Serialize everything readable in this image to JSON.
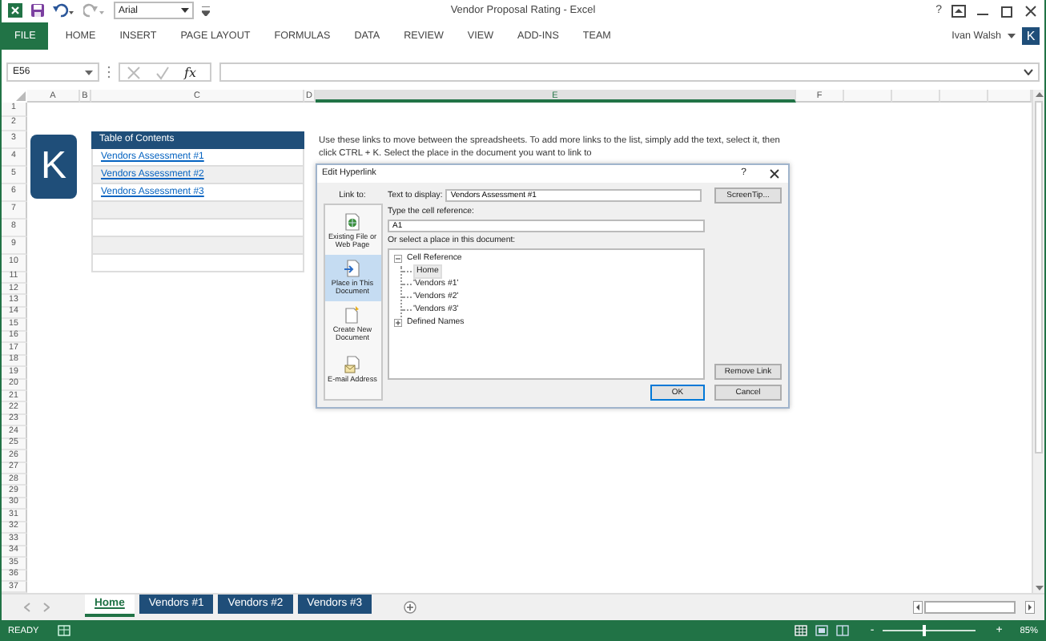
{
  "title_bar": {
    "font_box": "Arial",
    "title": "Vendor Proposal Rating - Excel",
    "help": "?"
  },
  "ribbon_tabs": [
    {
      "label": "FILE",
      "kind": "file"
    },
    {
      "label": "HOME",
      "kind": "tab"
    },
    {
      "label": "INSERT",
      "kind": "tab"
    },
    {
      "label": "PAGE LAYOUT",
      "kind": "tab"
    },
    {
      "label": "FORMULAS",
      "kind": "tab"
    },
    {
      "label": "DATA",
      "kind": "tab"
    },
    {
      "label": "REVIEW",
      "kind": "tab"
    },
    {
      "label": "VIEW",
      "kind": "tab"
    },
    {
      "label": "ADD-INS",
      "kind": "tab"
    },
    {
      "label": "TEAM",
      "kind": "tab"
    }
  ],
  "account": {
    "user": "Ivan Walsh",
    "avatar": "K"
  },
  "formula_bar": {
    "name_box": "E56",
    "function_label": "fx"
  },
  "columns": [
    "A",
    "B",
    "C",
    "D",
    "E",
    "F"
  ],
  "rows": [
    "1",
    "2",
    "3",
    "4",
    "5",
    "6",
    "7",
    "8",
    "9",
    "10",
    "11",
    "12",
    "13",
    "14",
    "15",
    "16",
    "17",
    "18",
    "19",
    "20",
    "21",
    "22",
    "23",
    "24",
    "25",
    "26",
    "27",
    "28",
    "29",
    "30",
    "31",
    "32",
    "33",
    "34",
    "35",
    "36",
    "37"
  ],
  "logo": {
    "letter": "K"
  },
  "toc": {
    "title": "Table of Contents",
    "links": [
      "Vendors Assessment #1",
      "Vendors Assessment #2",
      "Vendors Assessment #3"
    ]
  },
  "instructions": "Use these links to move between the spreadsheets. To add more links to the list, simply add the text, select it, then click CTRL + K. Select the place in the document you want to link to",
  "dialog": {
    "title": "Edit Hyperlink",
    "help": "?",
    "link_to_label": "Link to:",
    "places": [
      {
        "label": "Existing File or Web Page",
        "selected": false
      },
      {
        "label": "Place in This Document",
        "selected": true
      },
      {
        "label": "Create New Document",
        "selected": false
      },
      {
        "label": "E-mail Address",
        "selected": false
      }
    ],
    "text_to_display_label": "Text to display:",
    "text_to_display": "Vendors Assessment #1",
    "screentip_button": "ScreenTip...",
    "cell_reference_label": "Type the cell reference:",
    "cell_reference": "A1",
    "select_place_label": "Or select a place in this document:",
    "tree": [
      {
        "label": "Cell Reference",
        "expanded": true,
        "children": [
          {
            "label": "Home",
            "selected": true
          },
          {
            "label": "'Vendors #1'",
            "selected": false
          },
          {
            "label": "'Vendors #2'",
            "selected": false
          },
          {
            "label": "'Vendors #3'",
            "selected": false
          }
        ]
      },
      {
        "label": "Defined Names",
        "expanded": false
      }
    ],
    "remove_link_button": "Remove Link",
    "ok_button": "OK",
    "cancel_button": "Cancel"
  },
  "sheet_tabs": [
    {
      "label": "Home",
      "selected": true
    },
    {
      "label": "Vendors #1",
      "selected": false
    },
    {
      "label": "Vendors #2",
      "selected": false
    },
    {
      "label": "Vendors #3",
      "selected": false
    }
  ],
  "status_bar": {
    "status": "READY",
    "zoom_out": "-",
    "zoom_in": "+",
    "zoom": {
      "level": 0.45,
      "reading": "85%"
    }
  }
}
